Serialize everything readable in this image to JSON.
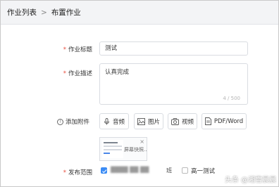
{
  "breadcrumb": {
    "parent": "作业列表",
    "separator": ">",
    "current": "布置作业"
  },
  "form": {
    "title": {
      "label": "作业标题",
      "value": "测试"
    },
    "description": {
      "label": "作业描述",
      "value": "认真完成",
      "counter": "4 / 500"
    },
    "attachments": {
      "label": "添加附件",
      "buttons": [
        {
          "label": "音频",
          "icon": "microphone-icon"
        },
        {
          "label": "图片",
          "icon": "image-icon"
        },
        {
          "label": "视频",
          "icon": "camera-icon"
        },
        {
          "label": "PDF/Word",
          "icon": "document-icon"
        }
      ],
      "file": {
        "caption": "屏幕快照...",
        "close": "×"
      }
    },
    "publish": {
      "label": "发布范围",
      "options": [
        {
          "label": "班",
          "blurred": "████ ██ ██",
          "checked": true
        },
        {
          "label": "高一测试",
          "checked": false
        }
      ]
    }
  },
  "watermark": "头条 @湘雪晨晨",
  "colors": {
    "accent": "#3b8cf5",
    "required": "#e74c3c"
  }
}
